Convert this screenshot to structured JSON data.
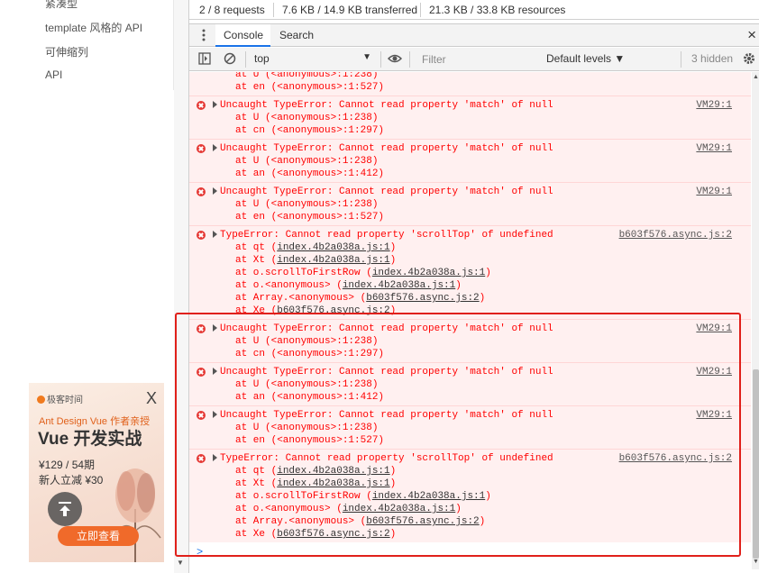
{
  "docs": {
    "nav": [
      "紧凑型",
      "template 风格的 API",
      "可伸缩列",
      "API"
    ]
  },
  "ad": {
    "logo": "极客时间",
    "close": "X",
    "subtitle": "Ant Design Vue 作者亲授",
    "title": "Vue 开发实战",
    "price": "¥129 / 54期",
    "discount": "新人立减 ¥30",
    "button": "立即查看"
  },
  "network_summary": {
    "requests": "2 / 8 requests",
    "transferred": "7.6 KB / 14.9 KB transferred",
    "resources": "21.3 KB / 33.8 KB resources"
  },
  "drawer": {
    "tabs": [
      "Console",
      "Search"
    ],
    "active_tab": "Console",
    "close": "×"
  },
  "toolbar": {
    "context": "top",
    "filter_placeholder": "Filter",
    "levels": "Default levels ▼",
    "hidden": "3 hidden"
  },
  "messages": [
    {
      "top": 0,
      "partial": true,
      "stack": [
        "at U (<anonymous>:1:238)",
        "at en (<anonymous>:1:527)"
      ],
      "source": ""
    },
    {
      "text": "Uncaught TypeError: Cannot read property 'match' of null",
      "stack": [
        "at U (<anonymous>:1:238)",
        "at cn (<anonymous>:1:297)"
      ],
      "source": "VM29:1"
    },
    {
      "text": "Uncaught TypeError: Cannot read property 'match' of null",
      "stack": [
        "at U (<anonymous>:1:238)",
        "at an (<anonymous>:1:412)"
      ],
      "source": "VM29:1"
    },
    {
      "text": "Uncaught TypeError: Cannot read property 'match' of null",
      "stack": [
        "at U (<anonymous>:1:238)",
        "at en (<anonymous>:1:527)"
      ],
      "source": "VM29:1"
    },
    {
      "text": "TypeError: Cannot read property 'scrollTop' of undefined",
      "stack": [
        "at qt (index.4b2a038a.js:1)",
        "at Xt (index.4b2a038a.js:1)",
        "at o.scrollToFirstRow (index.4b2a038a.js:1)",
        "at o.<anonymous> (index.4b2a038a.js:1)",
        "at Array.<anonymous> (b603f576.async.js:2)",
        "at Xe (b603f576.async.js:2)"
      ],
      "source": "b603f576.async.js:2"
    },
    {
      "text": "Uncaught TypeError: Cannot read property 'match' of null",
      "stack": [
        "at U (<anonymous>:1:238)",
        "at cn (<anonymous>:1:297)"
      ],
      "source": "VM29:1"
    },
    {
      "text": "Uncaught TypeError: Cannot read property 'match' of null",
      "stack": [
        "at U (<anonymous>:1:238)",
        "at an (<anonymous>:1:412)"
      ],
      "source": "VM29:1"
    },
    {
      "text": "Uncaught TypeError: Cannot read property 'match' of null",
      "stack": [
        "at U (<anonymous>:1:238)",
        "at en (<anonymous>:1:527)"
      ],
      "source": "VM29:1"
    },
    {
      "text": "TypeError: Cannot read property 'scrollTop' of undefined",
      "stack": [
        "at qt (index.4b2a038a.js:1)",
        "at Xt (index.4b2a038a.js:1)",
        "at o.scrollToFirstRow (index.4b2a038a.js:1)",
        "at o.<anonymous> (index.4b2a038a.js:1)",
        "at Array.<anonymous> (b603f576.async.js:2)",
        "at Xe (b603f576.async.js:2)"
      ],
      "source": "b603f576.async.js:2"
    }
  ],
  "prompt": ">",
  "colors": {
    "error_text": "#ff0000",
    "error_bg": "#fff0f0",
    "highlight": "#e0201a",
    "accent": "#1a73e8"
  }
}
